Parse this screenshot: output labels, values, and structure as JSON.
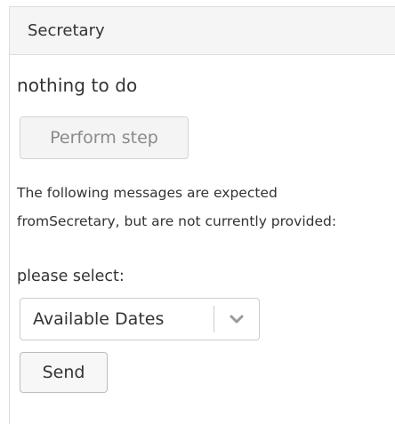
{
  "panel": {
    "title": "Secretary"
  },
  "status": {
    "text": "nothing to do"
  },
  "actions": {
    "perform_label": "Perform step",
    "send_label": "Send"
  },
  "messages": {
    "line1": "The following messages are expected",
    "line2": "fromSecretary, but are not currently provided:"
  },
  "select": {
    "label": "please select:",
    "value": "Available Dates"
  },
  "icons": {
    "dropdown": "chevron-down-icon"
  },
  "colors": {
    "heading_bg": "#f5f5f5",
    "border": "#dddddd",
    "text": "#333333",
    "disabled_text": "#8a8a8a",
    "chevron": "#9a9a9a"
  }
}
